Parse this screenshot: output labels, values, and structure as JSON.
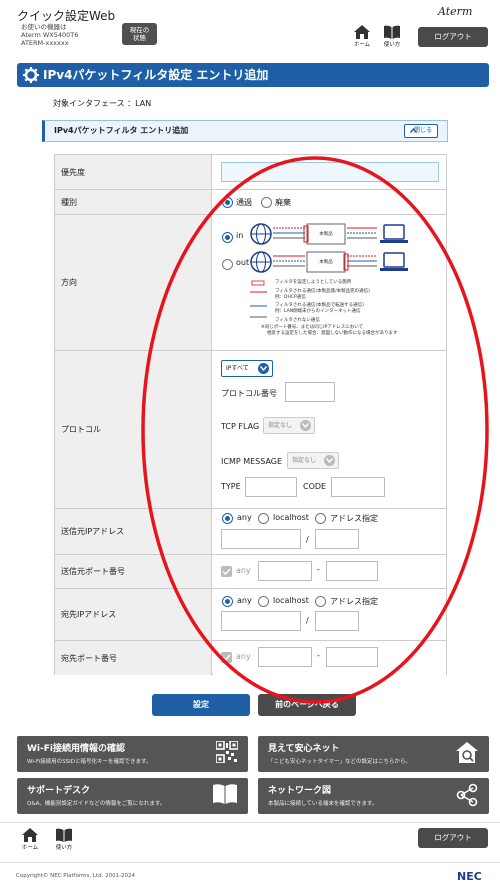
{
  "header": {
    "title": "クイック設定Web",
    "device_line1": "お使いの機器は",
    "device_line2": "Aterm WX5400T6",
    "device_line3": "ATERM-xxxxxx",
    "status_btn_line1": "現在の",
    "status_btn_line2": "状態",
    "brand": "Aterm",
    "home": "ホーム",
    "help": "使い方",
    "logout": "ログアウト"
  },
  "page_title": "IPv4パケットフィルタ設定 エントリ追加",
  "interface": "対象インタフェース ：LAN",
  "section": {
    "title": "IPv4パケットフィルタ エントリ追加",
    "close": "閉じる"
  },
  "form": {
    "priority": {
      "label": "優先度",
      "value": ""
    },
    "type": {
      "label": "種別",
      "options": [
        "通過",
        "廃棄"
      ],
      "selected": "通過"
    },
    "direction": {
      "label": "方向",
      "options": [
        "in",
        "out"
      ],
      "selected": "in",
      "diagram_label": "本製品",
      "legend": [
        "フィルタを設定しようとしている箇所",
        "フィルタされる通信(本製品発/本製品宛の通信)",
        "例：DHCP通信",
        "フィルタされる通信(本製品で転送する通信)",
        "例：LAN側端末からのインターネット通信",
        "フィルタされない通信",
        "※同じポート番号、または同じIPアドレスにおいて",
        "相反する設定をした場合、意図しない動作になる場合があります"
      ]
    },
    "protocol": {
      "label": "プロトコル",
      "ip_select": "IPすべて",
      "protocol_number_label": "プロトコル番号",
      "tcp_flag_label": "TCP FLAG",
      "tcp_flag_value": "指定なし",
      "icmp_label": "ICMP MESSAGE",
      "icmp_value": "指定なし",
      "type_label": "TYPE",
      "code_label": "CODE"
    },
    "src_ip": {
      "label": "送信元IPアドレス",
      "options": [
        "any",
        "localhost",
        "アドレス指定"
      ],
      "selected": "any",
      "slash": "/"
    },
    "src_port": {
      "label": "送信元ポート番号",
      "any": "any",
      "dash": "-"
    },
    "dst_ip": {
      "label": "宛先IPアドレス",
      "options": [
        "any",
        "localhost",
        "アドレス指定"
      ],
      "selected": "any",
      "slash": "/"
    },
    "dst_port": {
      "label": "宛先ポート番号",
      "any": "any",
      "dash": "-"
    }
  },
  "buttons": {
    "submit": "設定",
    "back": "前のページへ戻る"
  },
  "cards": [
    {
      "title": "Wi-Fi接続用情報の確認",
      "desc": "Wi-Fi接続用のSSIDと暗号化キーを確認できます。",
      "icon": "qr-code-icon"
    },
    {
      "title": "見えて安心ネット",
      "desc": "「こども安心ネットタイマー」などの設定はこちらから。",
      "icon": "house-search-icon"
    },
    {
      "title": "サポートデスク",
      "desc": "Q&A、機能別設定ガイドなどの情報をご覧になれます。",
      "icon": "book-icon"
    },
    {
      "title": "ネットワーク図",
      "desc": "本製品に接続している端末を確認できます。",
      "icon": "network-icon"
    }
  ],
  "footer": {
    "home": "ホーム",
    "help": "使い方",
    "logout": "ログアウト",
    "copyright": "Copyright© NEC Platforms, Ltd. 2001-2024",
    "nec": "NEC"
  },
  "colors": {
    "accent": "#1e5fa8",
    "annotation": "#e8141c",
    "dark_button": "#4a4a4a"
  }
}
